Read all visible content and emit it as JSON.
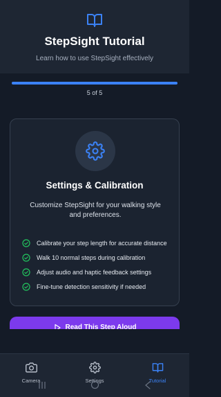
{
  "header": {
    "icon": "book-open-icon",
    "title": "StepSight Tutorial",
    "subtitle": "Learn how to use StepSight effectively"
  },
  "progress": {
    "fraction": 1.0,
    "text": "5 of 5"
  },
  "card": {
    "icon": "gear-icon",
    "title": "Settings & Calibration",
    "description": "Customize StepSight for your walking style and preferences.",
    "items": [
      "Calibrate your step length for accurate distance",
      "Walk 10 normal steps during calibration",
      "Adjust audio and haptic feedback settings",
      "Fine-tune detection sensitivity if needed"
    ]
  },
  "read_button": {
    "label": "Read This Step Aloud"
  },
  "bottom_nav": {
    "items": [
      {
        "label": "Camera",
        "icon": "camera-icon",
        "active": false
      },
      {
        "label": "Settings",
        "icon": "gear-icon",
        "active": false
      },
      {
        "label": "Tutorial",
        "icon": "book-open-icon",
        "active": true
      }
    ]
  },
  "colors": {
    "accent": "#3b82f6",
    "button": "#7c3aed",
    "check": "#22c55e",
    "background": "#141b27"
  }
}
